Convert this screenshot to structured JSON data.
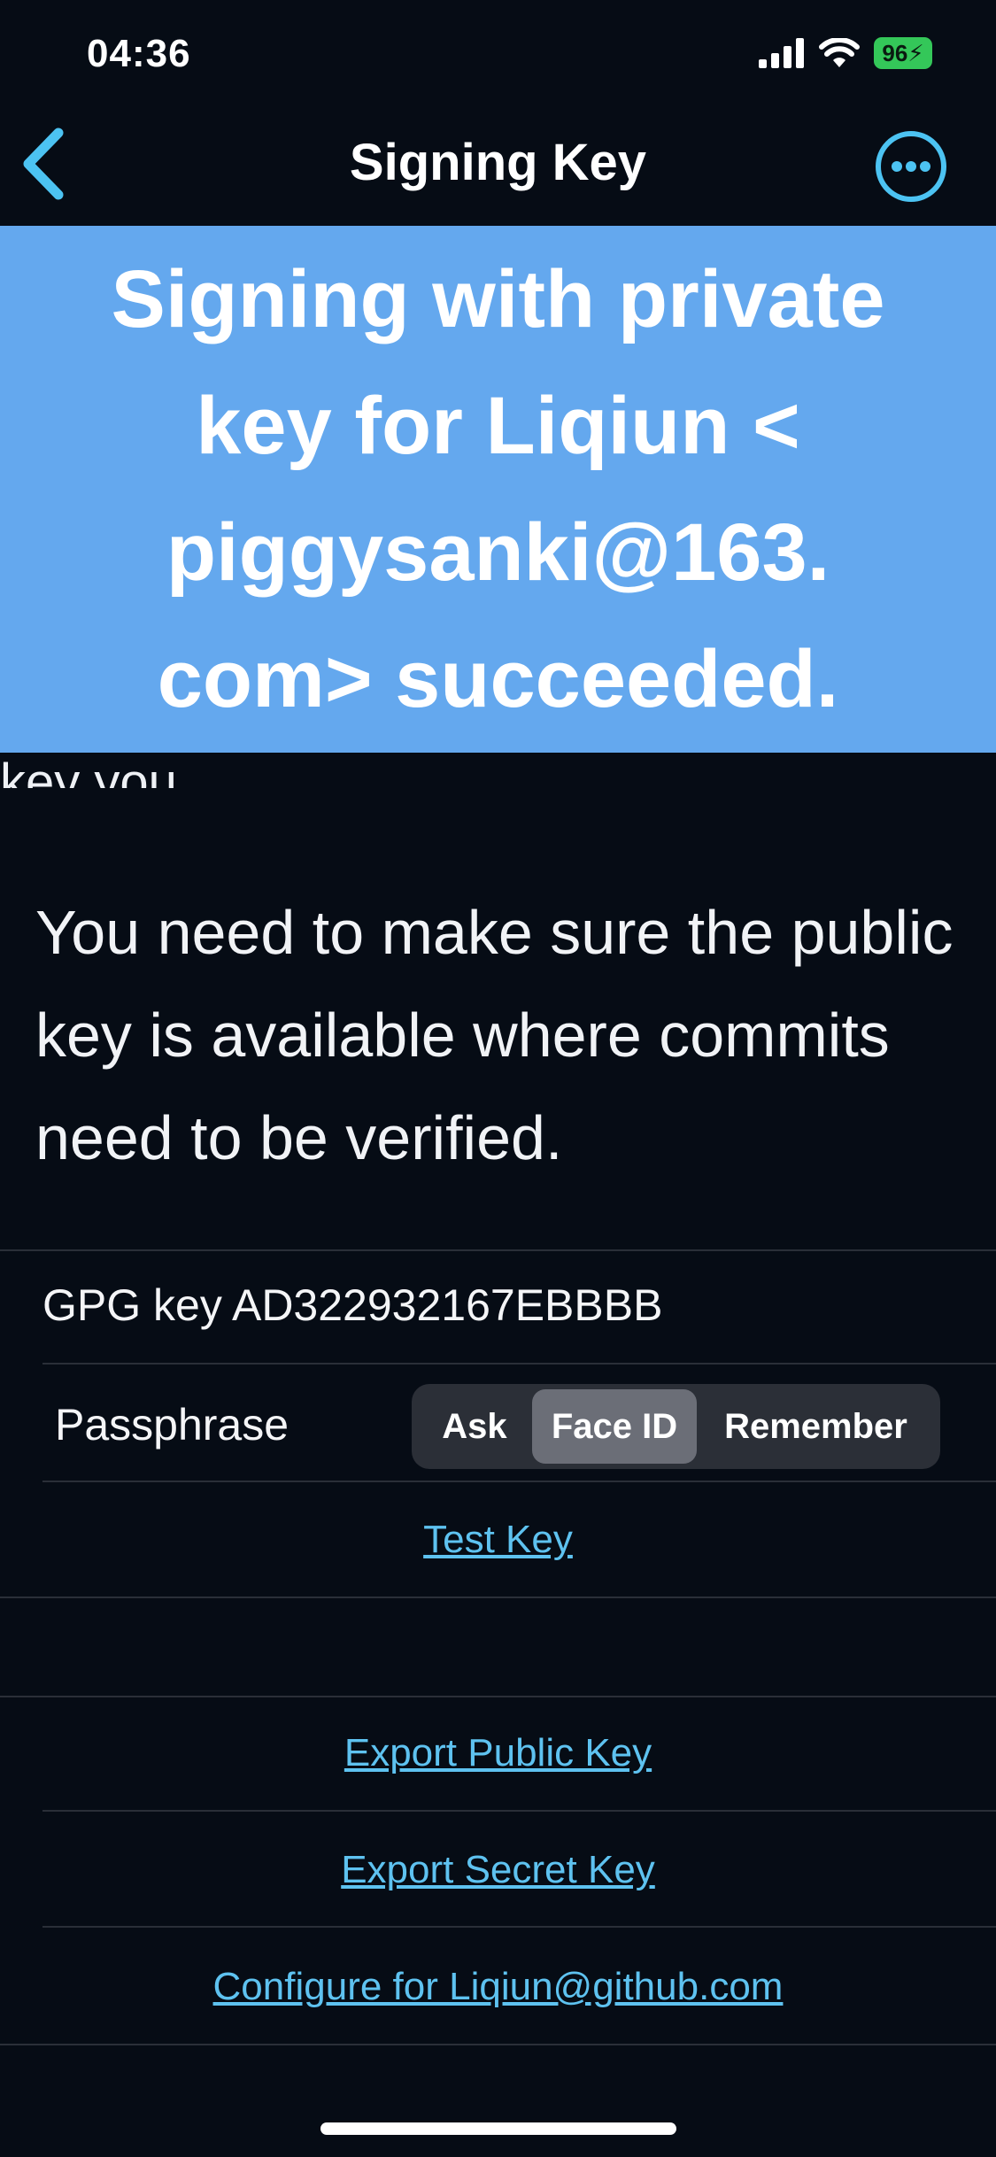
{
  "status_bar": {
    "time": "04:36",
    "battery": "96",
    "icons": [
      "cellular-signal-icon",
      "wifi-icon",
      "battery-charging-icon"
    ]
  },
  "nav": {
    "title": "Signing Key",
    "back_icon": "chevron-left-icon",
    "more_icon": "ellipsis-circle-icon"
  },
  "toast": {
    "message": "Signing with private key for Liqiun < piggysanki@163. com> succeeded.",
    "partially_hidden_text": "key you"
  },
  "info": {
    "text": "You need to make sure the public key is available where commits need to be verified."
  },
  "key_section": {
    "key_label": "GPG key AD322932167EBBBB",
    "passphrase_label": "Passphrase",
    "passphrase_options": [
      "Ask",
      "Face ID",
      "Remember"
    ],
    "passphrase_selected": "Face ID",
    "test_key": "Test Key"
  },
  "export_section": {
    "export_public": "Export Public Key",
    "export_secret": "Export Secret Key",
    "configure": "Configure for Liqiun@github.com"
  },
  "colors": {
    "background": "#060c15",
    "toast": "#64a8ee",
    "accent": "#5ec2f0",
    "separator": "#2a2f38",
    "segment_selected": "#6b6e77"
  }
}
